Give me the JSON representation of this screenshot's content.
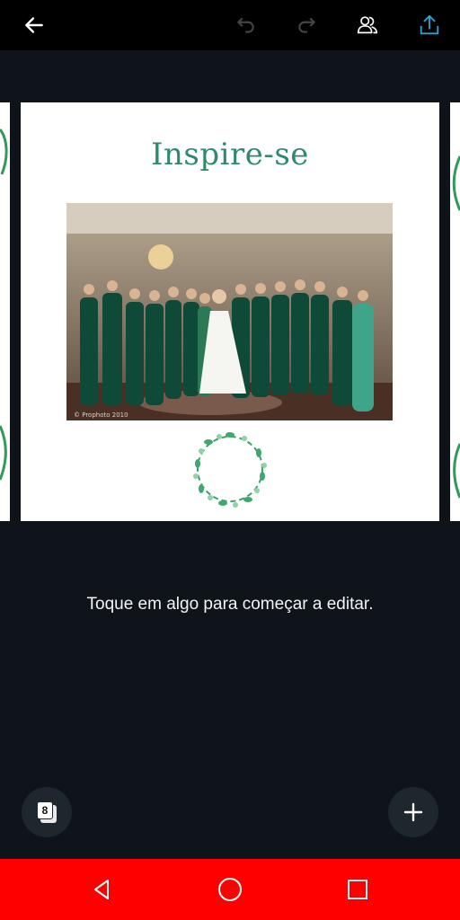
{
  "toolbar": {
    "back_icon": "arrow-left-icon",
    "undo_icon": "undo-icon",
    "redo_icon": "redo-icon",
    "collaborate_icon": "people-icon",
    "share_icon": "upload-icon"
  },
  "design": {
    "title": "Inspire-se",
    "photo_watermark": "© Prophoto 2010",
    "title_color": "#2f8a68"
  },
  "hint_text": "Toque em algo para começar a editar.",
  "pages_button": {
    "count": "8",
    "icon": "pages-icon"
  },
  "add_button": {
    "icon": "plus-icon"
  },
  "system_nav": {
    "back_icon": "triangle-back-icon",
    "home_icon": "circle-home-icon",
    "recents_icon": "square-recents-icon",
    "bar_color": "#ff0000"
  }
}
